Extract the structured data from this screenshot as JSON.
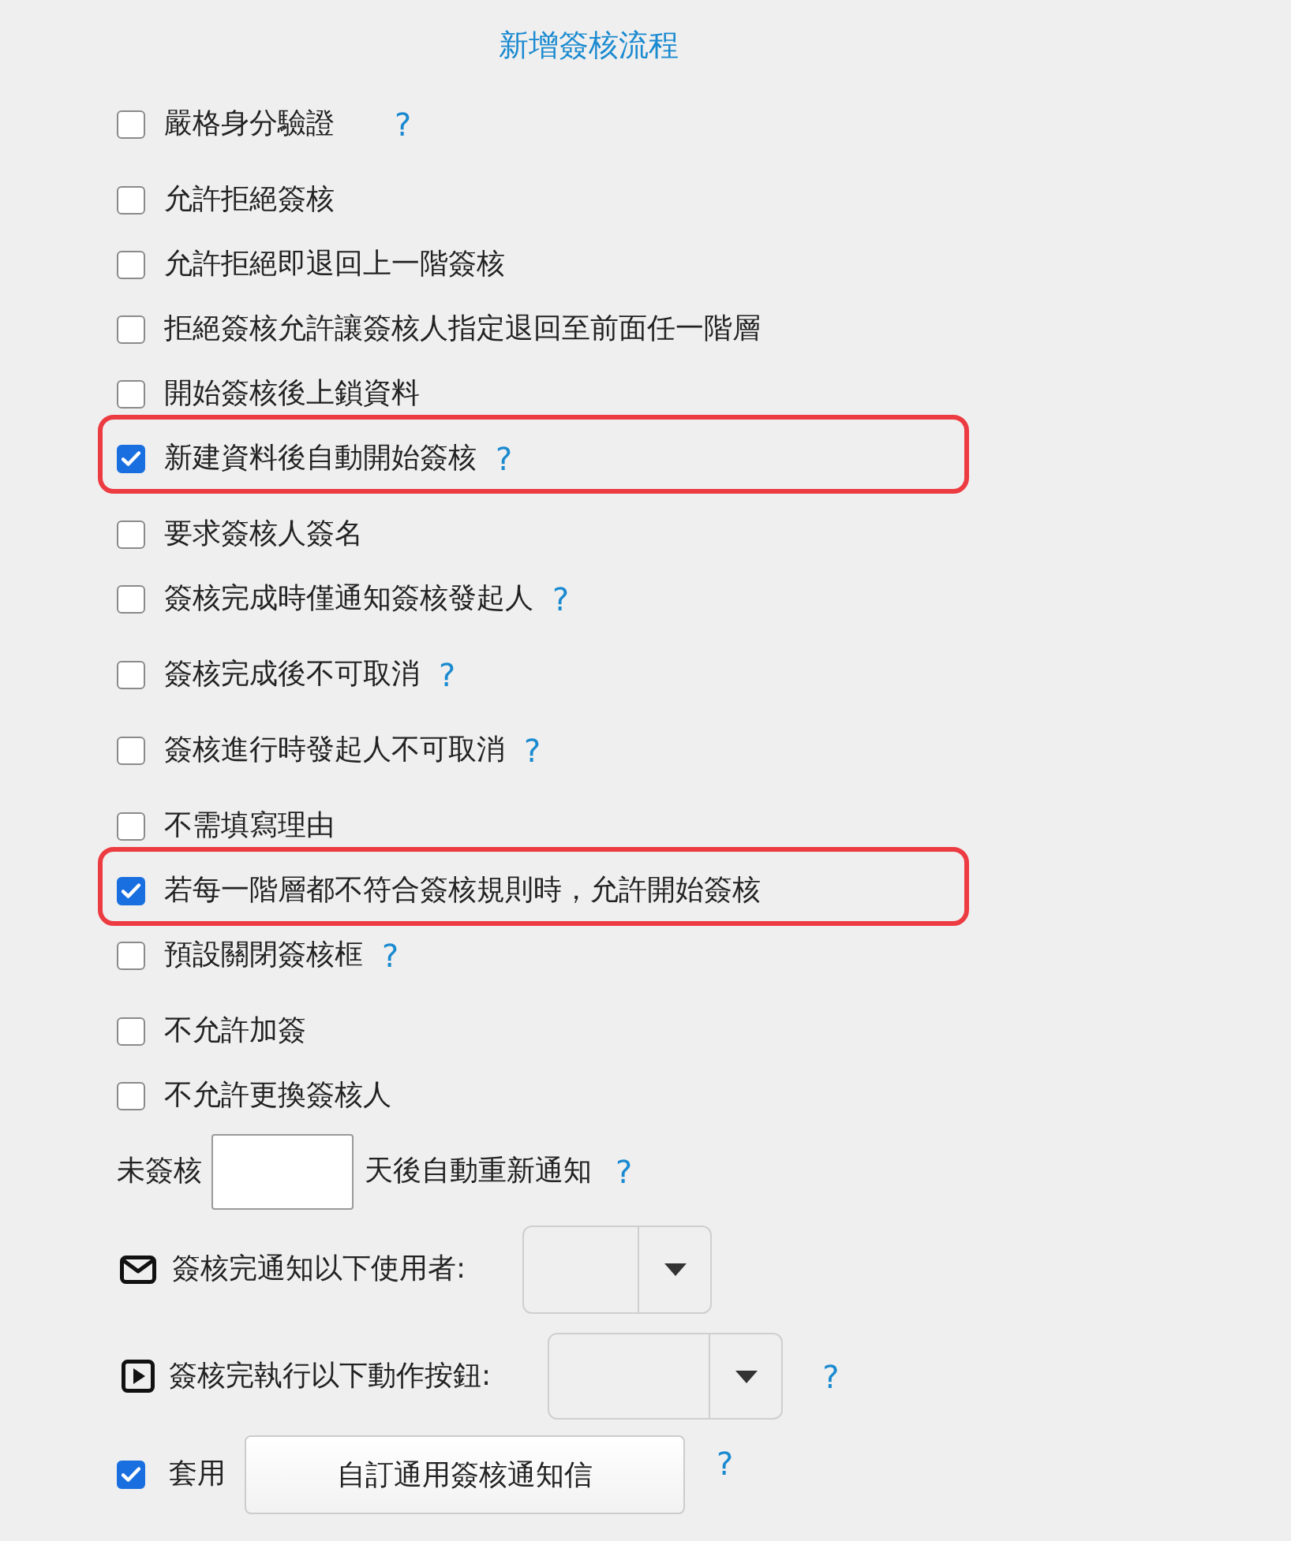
{
  "title": "新增簽核流程",
  "options": [
    {
      "label": "嚴格身分驗證",
      "checked": false,
      "highlighted": false,
      "help": "?"
    },
    {
      "label": "允許拒絕簽核",
      "checked": false,
      "highlighted": false
    },
    {
      "label": "允許拒絕即退回上一階簽核",
      "checked": false,
      "highlighted": false
    },
    {
      "label": "拒絕簽核允許讓簽核人指定退回至前面任一階層",
      "checked": false,
      "highlighted": false
    },
    {
      "label": "開始簽核後上鎖資料",
      "checked": false,
      "highlighted": false
    },
    {
      "label": "新建資料後自動開始簽核",
      "checked": true,
      "highlighted": true,
      "help": "?"
    },
    {
      "label": "要求簽核人簽名",
      "checked": false,
      "highlighted": false
    },
    {
      "label": "簽核完成時僅通知簽核發起人",
      "checked": false,
      "highlighted": false,
      "help": "?"
    },
    {
      "label": "簽核完成後不可取消",
      "checked": false,
      "highlighted": false,
      "help": "?"
    },
    {
      "label": "簽核進行時發起人不可取消",
      "checked": false,
      "highlighted": false,
      "help": "?"
    },
    {
      "label": "不需填寫理由",
      "checked": false,
      "highlighted": false
    },
    {
      "label": "若每一階層都不符合簽核規則時，允許開始簽核",
      "checked": true,
      "highlighted": true
    },
    {
      "label": "預設關閉簽核框",
      "checked": false,
      "highlighted": false,
      "help": "?"
    },
    {
      "label": "不允許加簽",
      "checked": false,
      "highlighted": false
    },
    {
      "label": "不允許更換簽核人",
      "checked": false,
      "highlighted": false
    }
  ],
  "reminder": {
    "prefix": "未簽核",
    "suffix": "天後自動重新通知",
    "help": "?"
  },
  "notify_users": {
    "label": "簽核完通知以下使用者:"
  },
  "action_buttons": {
    "label": "簽核完執行以下動作按鈕:",
    "help": "?"
  },
  "template": {
    "checked": true,
    "label": "套用",
    "button": "自訂通用簽核通知信",
    "help": "?"
  }
}
